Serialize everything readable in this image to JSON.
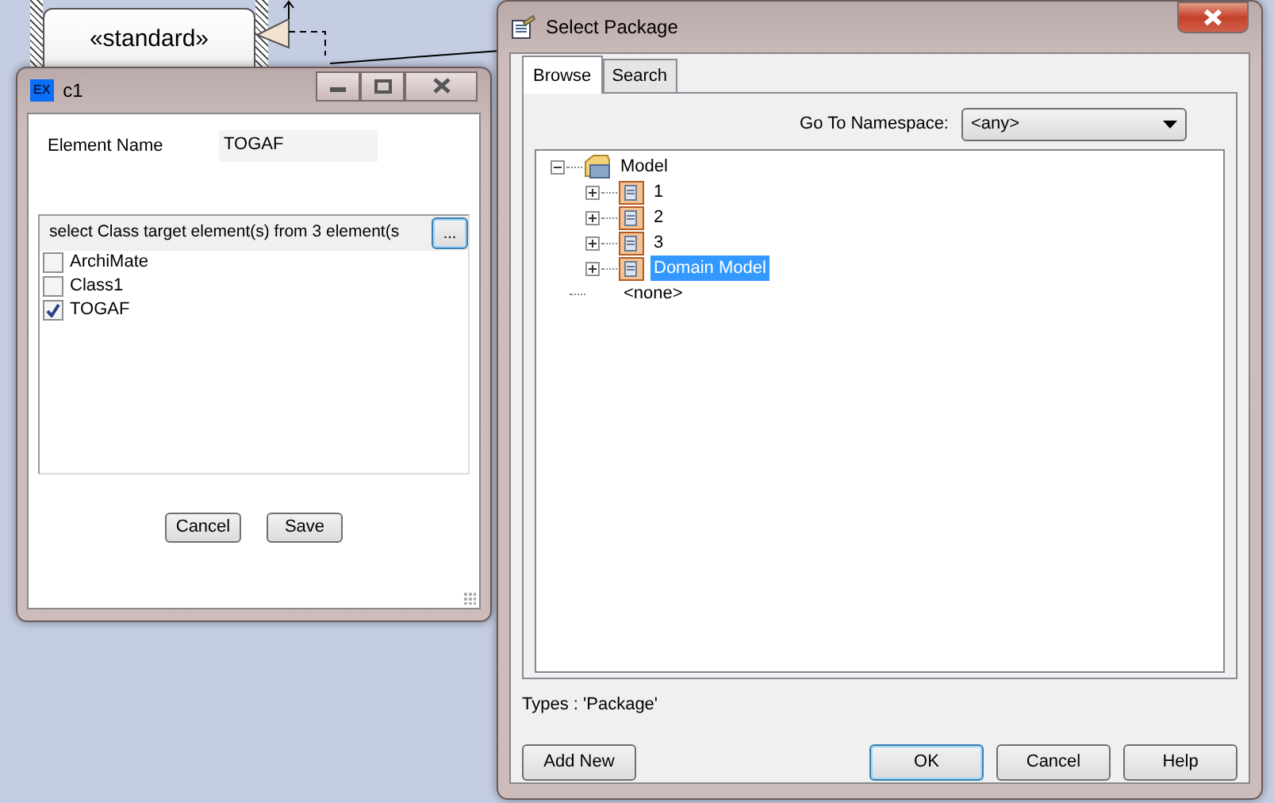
{
  "diagram": {
    "stereotype": "«standard»"
  },
  "element_dialog": {
    "title": "c1",
    "app_badge": "EX",
    "name_label": "Element Name",
    "name_value": "TOGAF",
    "list_header": "select Class target element(s) from 3 element(s",
    "browse_button": "...",
    "items": [
      {
        "label": "ArchiMate",
        "checked": false
      },
      {
        "label": "Class1",
        "checked": false
      },
      {
        "label": "TOGAF",
        "checked": true
      }
    ],
    "buttons": [
      "Cancel",
      "Save"
    ]
  },
  "package_dialog": {
    "title": "Select Package",
    "tabs": [
      {
        "label": "Browse",
        "selected": true
      },
      {
        "label": "Search",
        "selected": false
      }
    ],
    "namespace_label": "Go To Namespace:",
    "namespace_value": "<any>",
    "tree": [
      {
        "label": "Model",
        "kind": "model",
        "expanded": true,
        "selected": false,
        "children": [
          {
            "label": "1",
            "kind": "package",
            "expanded": false,
            "selected": false
          },
          {
            "label": "2",
            "kind": "package",
            "expanded": false,
            "selected": false
          },
          {
            "label": "3",
            "kind": "package",
            "expanded": false,
            "selected": false
          },
          {
            "label": "Domain Model",
            "kind": "package",
            "expanded": false,
            "selected": true
          }
        ]
      },
      {
        "label": "<none>",
        "kind": "none",
        "selected": false
      }
    ],
    "types_text": "Types : 'Package'",
    "add_button": "Add New",
    "buttons": [
      {
        "label": "OK",
        "default": true
      },
      {
        "label": "Cancel",
        "default": false
      },
      {
        "label": "Help",
        "default": false
      }
    ]
  }
}
